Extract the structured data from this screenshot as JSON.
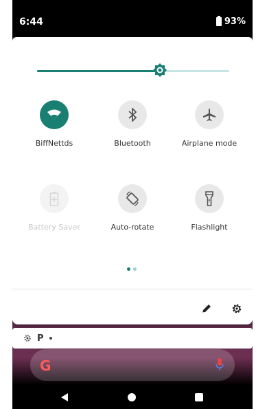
{
  "status_bar": {
    "time": "6:44",
    "battery_percent": "93%"
  },
  "brightness": {
    "level": 0.64
  },
  "tiles": [
    {
      "label": "BiffNettds",
      "icon": "wifi-icon",
      "state": "active"
    },
    {
      "label": "Bluetooth",
      "icon": "bluetooth-icon",
      "state": "inactive"
    },
    {
      "label": "Airplane mode",
      "icon": "airplane-icon",
      "state": "inactive"
    },
    {
      "label": "Battery Saver",
      "icon": "battery-saver-icon",
      "state": "disabled"
    },
    {
      "label": "Auto-rotate",
      "icon": "auto-rotate-icon",
      "state": "inactive"
    },
    {
      "label": "Flashlight",
      "icon": "flashlight-icon",
      "state": "inactive"
    }
  ],
  "page_indicator": {
    "total": 2,
    "current": 1
  },
  "notification_bar": {
    "app_letter": "P"
  },
  "search": {
    "logo": "G"
  },
  "colors": {
    "accent": "#1a7f73",
    "accent_light": "#c7e4e4",
    "disabled_text": "#c8c8c8"
  }
}
